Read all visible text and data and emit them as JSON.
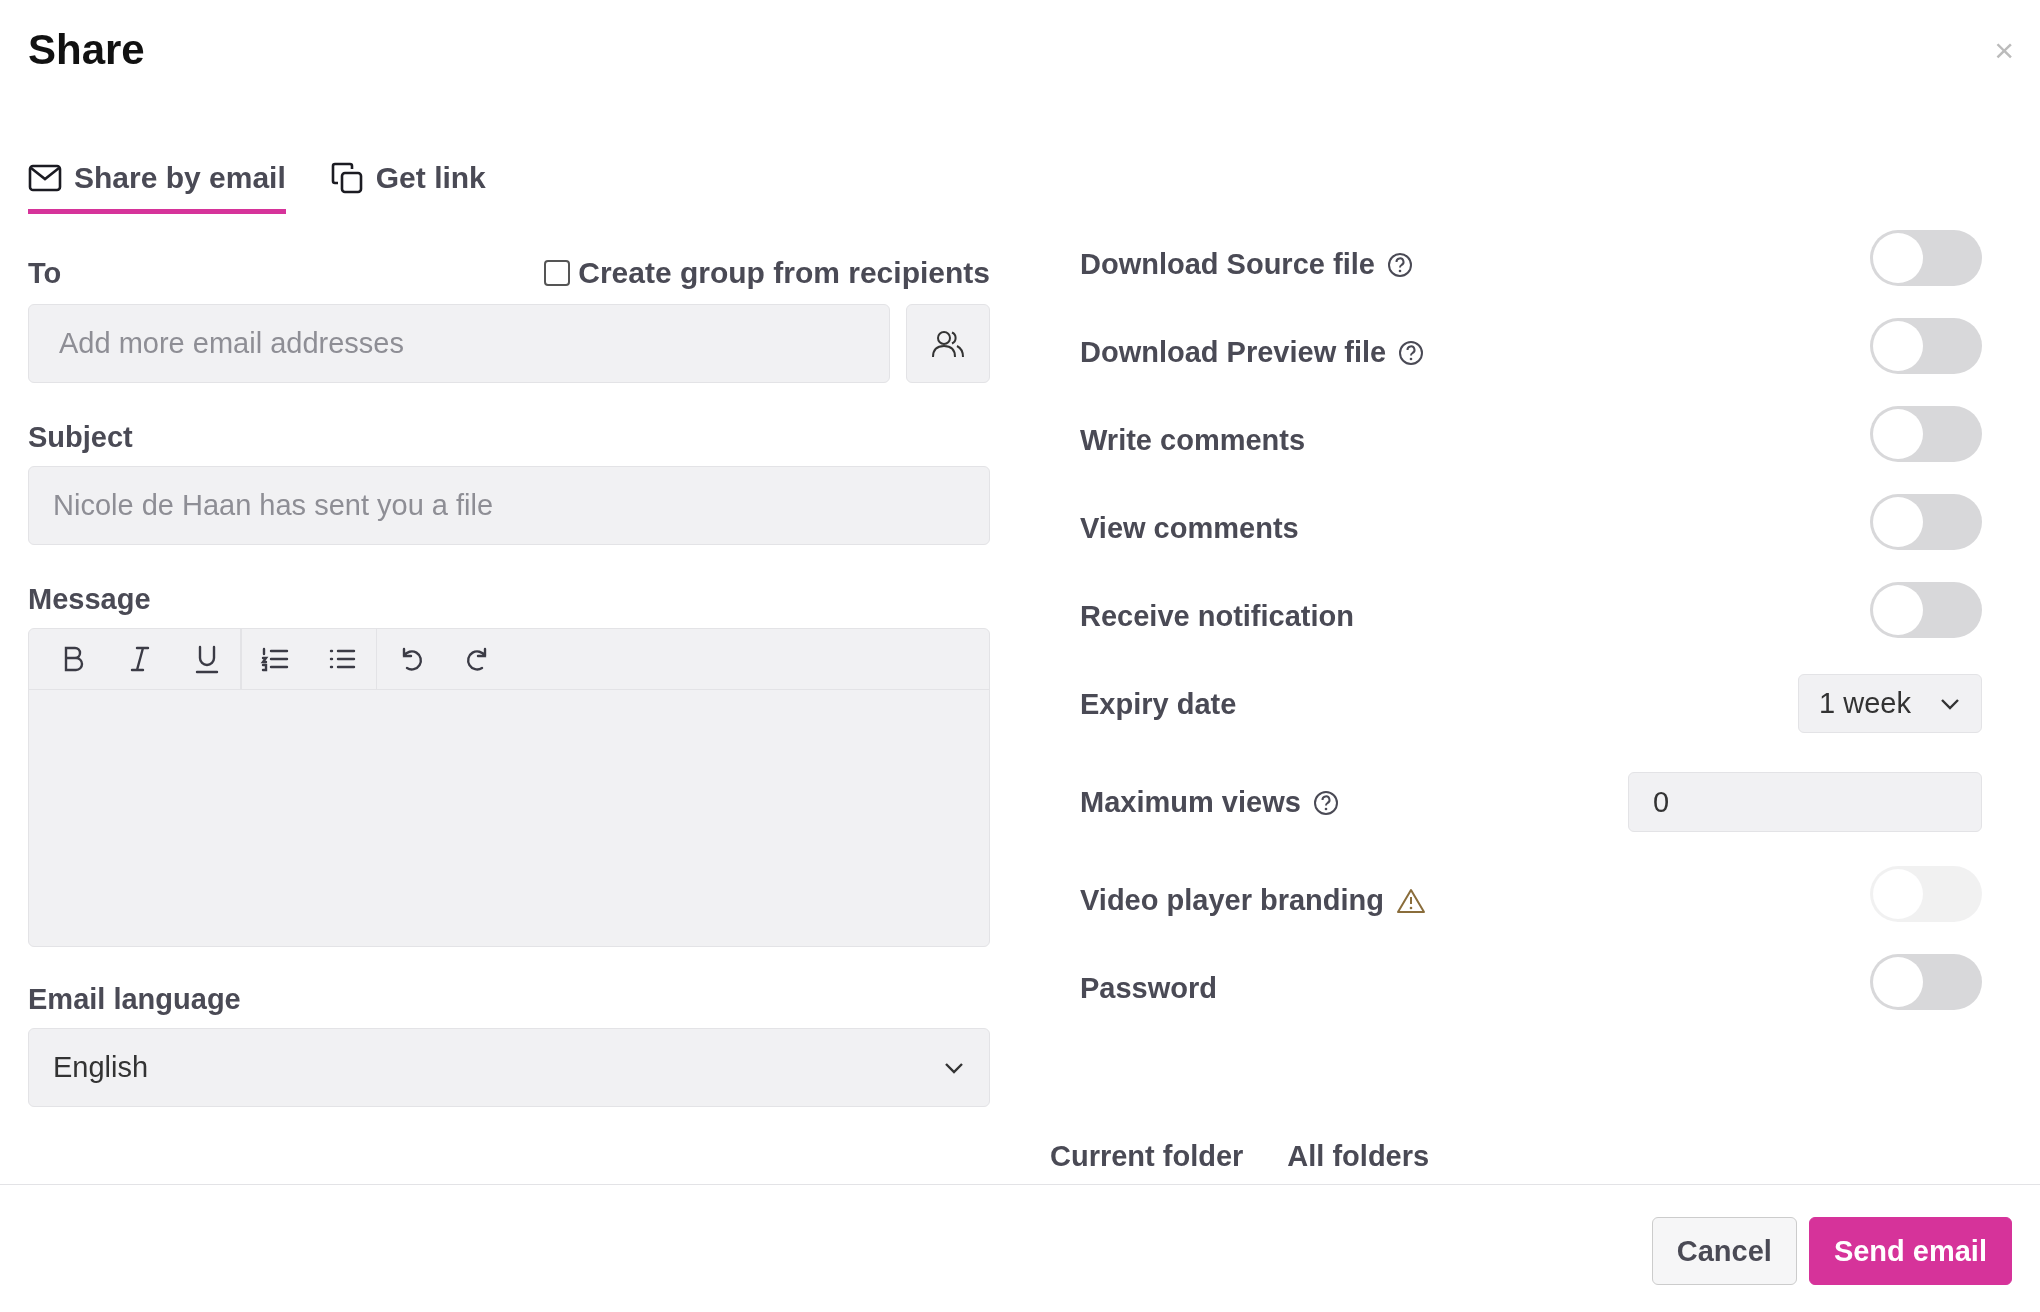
{
  "dialog": {
    "title": "Share",
    "close": "×"
  },
  "tabs": [
    {
      "label": "Share by email",
      "selected": true
    },
    {
      "label": "Get link",
      "selected": false
    }
  ],
  "to": {
    "label": "To",
    "placeholder": "Add more email addresses",
    "group_checkbox": {
      "label": "Create group from recipients",
      "checked": false
    }
  },
  "subject": {
    "label": "Subject",
    "placeholder": "Nicole de Haan has sent you a file"
  },
  "message": {
    "label": "Message"
  },
  "email_language": {
    "label": "Email language",
    "value": "English"
  },
  "settings": [
    {
      "kind": "toggle",
      "label": "Download Source file",
      "help": true,
      "warning": false,
      "on": false,
      "disabled": false
    },
    {
      "kind": "toggle",
      "label": "Download Preview file",
      "help": true,
      "warning": false,
      "on": false,
      "disabled": false
    },
    {
      "kind": "toggle",
      "label": "Write comments",
      "help": false,
      "warning": false,
      "on": false,
      "disabled": false
    },
    {
      "kind": "toggle",
      "label": "View comments",
      "help": false,
      "warning": false,
      "on": false,
      "disabled": false
    },
    {
      "kind": "toggle",
      "label": "Receive notification",
      "help": false,
      "warning": false,
      "on": false,
      "disabled": false
    },
    {
      "kind": "select",
      "label": "Expiry date",
      "help": false,
      "warning": false,
      "value": "1 week"
    },
    {
      "kind": "number",
      "label": "Maximum views",
      "help": true,
      "warning": false,
      "value": "0"
    },
    {
      "kind": "toggle",
      "label": "Video player branding",
      "help": false,
      "warning": true,
      "on": false,
      "disabled": true
    },
    {
      "kind": "toggle",
      "label": "Password",
      "help": false,
      "warning": false,
      "on": false,
      "disabled": false
    }
  ],
  "folder_tabs": [
    "Current folder",
    "All folders"
  ],
  "buttons": [
    {
      "label": "Cancel",
      "kind": "secondary"
    },
    {
      "label": "Send email",
      "kind": "primary"
    }
  ]
}
